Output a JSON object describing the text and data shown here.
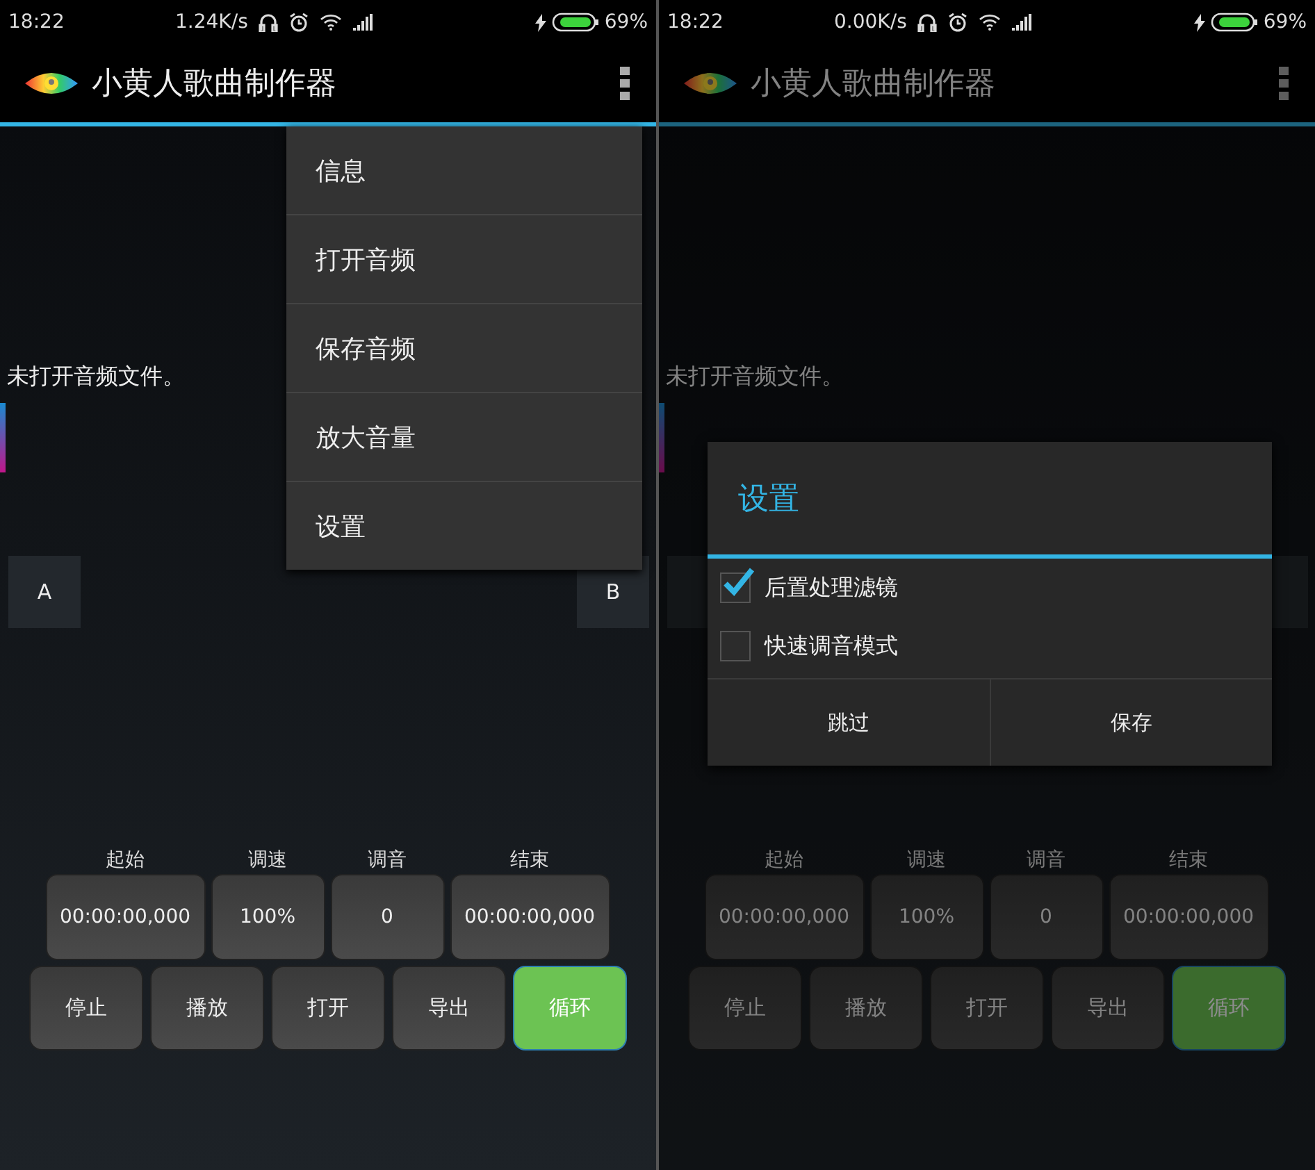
{
  "screens": [
    {
      "status_bar": {
        "time": "18:22",
        "speed": "1.24K/s",
        "battery": "69%"
      },
      "app_title": "小黄人歌曲制作器",
      "dimmed": false,
      "message": "未打开音频文件。",
      "ab_buttons": [
        "A",
        "B"
      ],
      "fields": [
        {
          "label": "起始",
          "value": "00:00:00,000"
        },
        {
          "label": "调速",
          "value": "100%"
        },
        {
          "label": "调音",
          "value": "0"
        },
        {
          "label": "结束",
          "value": "00:00:00,000"
        }
      ],
      "buttons": [
        {
          "label": "停止",
          "on": false
        },
        {
          "label": "播放",
          "on": false
        },
        {
          "label": "打开",
          "on": false
        },
        {
          "label": "导出",
          "on": false
        },
        {
          "label": "循环",
          "on": true
        }
      ],
      "menu": {
        "items": [
          "信息",
          "打开音频",
          "保存音频",
          "放大音量",
          "设置"
        ]
      }
    },
    {
      "status_bar": {
        "time": "18:22",
        "speed": "0.00K/s",
        "battery": "69%"
      },
      "app_title": "小黄人歌曲制作器",
      "dimmed": true,
      "message": "未打开音频文件。",
      "fields": [
        {
          "label": "起始",
          "value": "00:00:00,000"
        },
        {
          "label": "调速",
          "value": "100%"
        },
        {
          "label": "调音",
          "value": "0"
        },
        {
          "label": "结束",
          "value": "00:00:00,000"
        }
      ],
      "buttons": [
        {
          "label": "停止",
          "on": false
        },
        {
          "label": "播放",
          "on": false
        },
        {
          "label": "打开",
          "on": false
        },
        {
          "label": "导出",
          "on": false
        },
        {
          "label": "循环",
          "on": true
        }
      ],
      "dialog": {
        "title": "设置",
        "options": [
          {
            "label": "后置处理滤镜",
            "checked": true
          },
          {
            "label": "快速调音模式",
            "checked": false
          }
        ],
        "buttons": [
          "跳过",
          "保存"
        ]
      }
    }
  ]
}
